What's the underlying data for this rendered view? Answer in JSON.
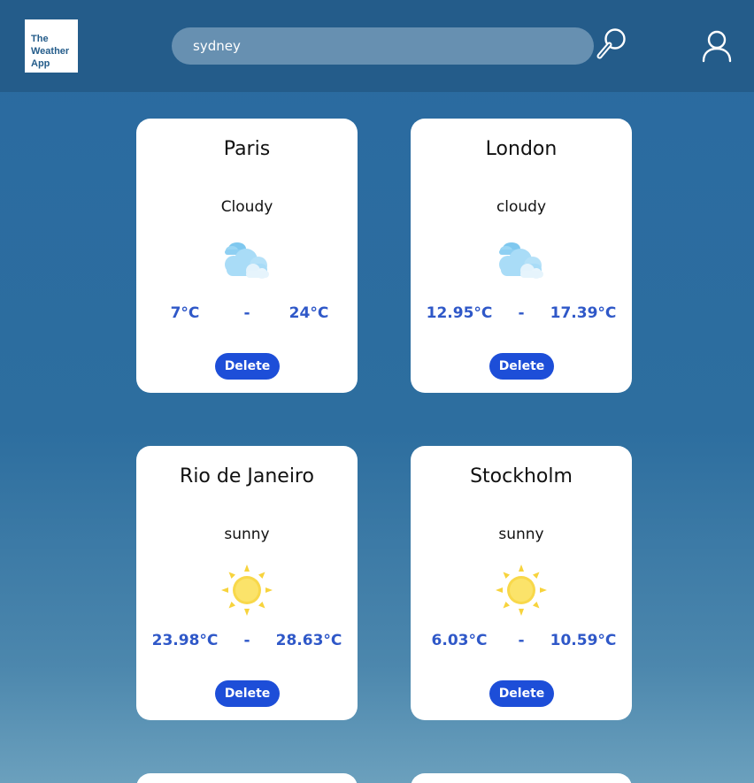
{
  "header": {
    "logo_lines": [
      "The",
      "Weather",
      "App"
    ],
    "search_value": "sydney"
  },
  "cards": [
    {
      "city": "Paris",
      "condition": "Cloudy",
      "icon": "cloudy-icon",
      "min": "7°C",
      "sep": "-",
      "max": "24°C",
      "delete_label": "Delete"
    },
    {
      "city": "London",
      "condition": "cloudy",
      "icon": "cloudy-icon",
      "min": "12.95°C",
      "sep": "-",
      "max": "17.39°C",
      "delete_label": "Delete"
    },
    {
      "city": "Rio de Janeiro",
      "condition": "sunny",
      "icon": "sun-icon",
      "min": "23.98°C",
      "sep": "-",
      "max": "28.63°C",
      "delete_label": "Delete"
    },
    {
      "city": "Stockholm",
      "condition": "sunny",
      "icon": "sun-icon",
      "min": "6.03°C",
      "sep": "-",
      "max": "10.59°C",
      "delete_label": "Delete"
    }
  ],
  "colors": {
    "header_bg": "#245c8a",
    "temp_text": "#2f58c8",
    "delete_button": "#1d4ed8"
  }
}
